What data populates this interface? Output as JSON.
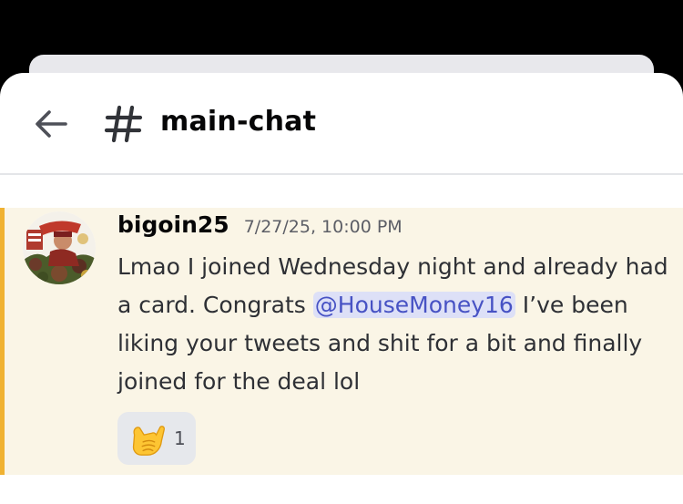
{
  "header": {
    "back_icon": "arrow-left-icon",
    "channel_icon": "hash-icon",
    "channel_name": "main-chat"
  },
  "message": {
    "username": "bigoin25",
    "timestamp": "7/27/25, 10:00 PM",
    "text_before_mention": "Lmao I joined Wednesday night and already had a card. Congrats ",
    "mention": "@HouseMoney16",
    "text_after_mention": " I’ve been liking your tweets and shit for a bit and finally joined for the deal lol",
    "reactions": [
      {
        "emoji": "call-me-hand-emoji",
        "count": "1"
      }
    ]
  },
  "colors": {
    "highlight_bar": "#f0b232",
    "highlight_bg": "#faf5e6",
    "mention_bg": "#dde0f7",
    "mention_text": "#4752c4"
  }
}
